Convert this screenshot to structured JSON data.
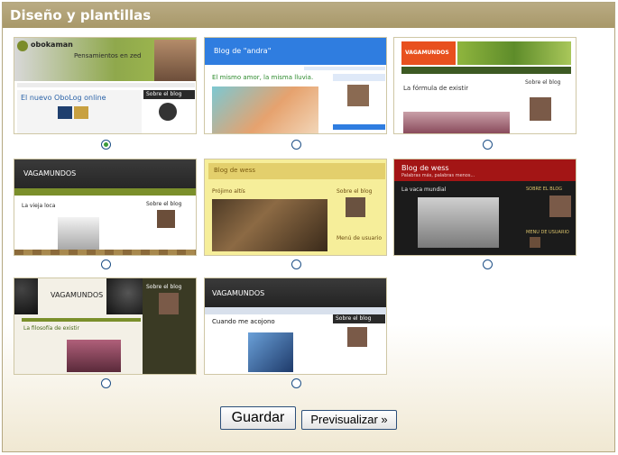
{
  "header": {
    "title": "Diseño y plantillas"
  },
  "templates": [
    {
      "banner": "obokaman",
      "tagline": "Pensamientos en zed",
      "post_title": "El nuevo OboLog online",
      "sidebar_heading": "Sobre el blog",
      "selected": true
    },
    {
      "banner": "Blog de \"andra\"",
      "post_title": "El mismo amor, la misma lluvia.",
      "selected": false
    },
    {
      "banner": "VAGAMUNDOS",
      "post_title": "La fórmula de existir",
      "sidebar_heading": "Sobre el blog",
      "selected": false
    },
    {
      "banner": "VAGAMUNDOS",
      "post_title": "La vieja loca",
      "sidebar_heading": "Sobre el blog",
      "selected": false
    },
    {
      "banner": "Blog de wess",
      "post_title": "Prójimo altís",
      "sidebar_heading": "Sobre el blog",
      "sidebar_heading2": "Menú de usuario",
      "selected": false
    },
    {
      "banner": "Blog de wess",
      "tagline": "Palabras más, palabras menos...",
      "post_title": "La vaca mundial",
      "sidebar_heading": "SOBRE EL BLOG",
      "sidebar_heading2": "MENÚ DE USUARIO",
      "selected": false
    },
    {
      "banner": "VAGAMUNDOS",
      "post_title": "La filosofía de existir",
      "sidebar_heading": "Sobre el blog",
      "selected": false
    },
    {
      "banner": "VAGAMUNDOS",
      "post_title": "Cuando me acojono",
      "sidebar_heading": "Sobre el blog",
      "selected": false
    }
  ],
  "buttons": {
    "save": "Guardar",
    "preview": "Previsualizar »"
  }
}
